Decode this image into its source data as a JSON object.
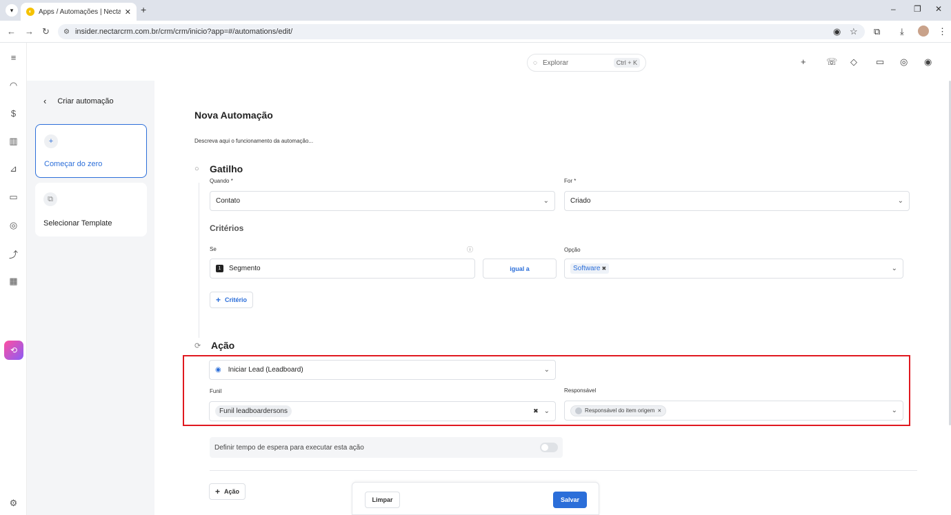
{
  "browser": {
    "tab_title": "Apps / Automações | NectarCRM",
    "tab_close": "✕",
    "new_tab": "+",
    "url": "insider.nectarcrm.com.br/crm/crm/inicio?app=#/automations/edit/"
  },
  "header": {
    "search_placeholder": "Explorar",
    "search_shortcut": "Ctrl + K"
  },
  "sidepanel": {
    "back_label": "Criar automação",
    "cards": [
      {
        "icon": "plus-icon",
        "label": "Começar do zero",
        "active": true
      },
      {
        "icon": "template-icon",
        "label": "Selecionar Template",
        "active": false
      }
    ]
  },
  "main": {
    "title": "Nova Automação",
    "description": "Descreva aqui o funcionamento da automação...",
    "trigger": {
      "heading": "Gatilho",
      "when_label": "Quando *",
      "when_value": "Contato",
      "for_label": "For *",
      "for_value": "Criado"
    },
    "criteria": {
      "heading": "Critérios",
      "if_label": "Se",
      "field_index": "1",
      "field_value": "Segmento",
      "operator": "igual a",
      "option_label": "Opção",
      "option_chip": "Software",
      "add_button": "Critério"
    },
    "action": {
      "heading": "Ação",
      "action_value": "Iniciar Lead (Leadboard)",
      "funnel_label": "Funil",
      "funnel_value": "Funil leadboardersons",
      "responsible_label": "Responsável",
      "responsible_value": "Responsável do item origem",
      "wait_label": "Definir tempo de espera para executar esta ação",
      "add_button": "Ação"
    },
    "footer": {
      "clear_label": "Limpar",
      "save_label": "Salvar"
    }
  },
  "colors": {
    "accent": "#2b6ed9",
    "highlight": "#e0181f"
  }
}
